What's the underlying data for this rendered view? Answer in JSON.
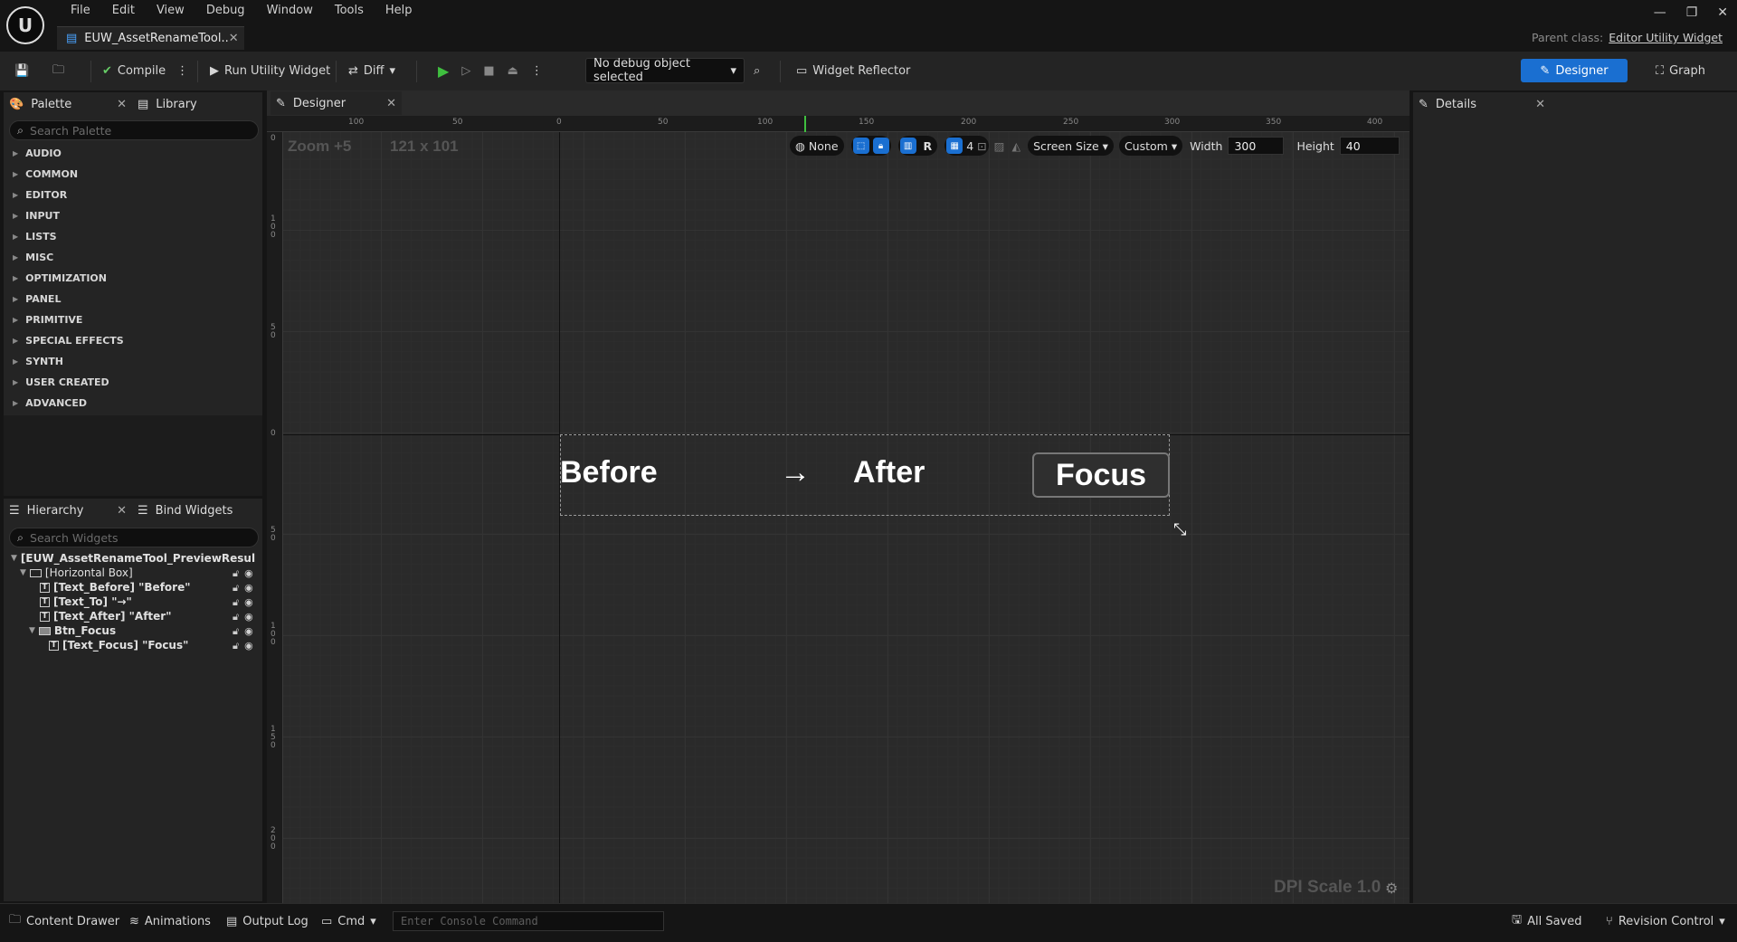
{
  "menu": [
    "File",
    "Edit",
    "View",
    "Debug",
    "Window",
    "Tools",
    "Help"
  ],
  "doc_tab": "EUW_AssetRenameTool..",
  "parent_class": {
    "label": "Parent class:",
    "value": "Editor Utility Widget"
  },
  "toolbar": {
    "compile": "Compile",
    "run": "Run Utility Widget",
    "diff": "Diff",
    "debug": "No debug object selected",
    "reflector": "Widget Reflector",
    "designer": "Designer",
    "graph": "Graph"
  },
  "palette": {
    "tab": "Palette",
    "library": "Library",
    "search_placeholder": "Search Palette",
    "categories": [
      "AUDIO",
      "COMMON",
      "EDITOR",
      "INPUT",
      "LISTS",
      "MISC",
      "OPTIMIZATION",
      "PANEL",
      "PRIMITIVE",
      "SPECIAL EFFECTS",
      "SYNTH",
      "USER CREATED",
      "ADVANCED"
    ]
  },
  "hierarchy": {
    "tab": "Hierarchy",
    "bind": "Bind Widgets",
    "search_placeholder": "Search Widgets",
    "items": [
      "[EUW_AssetRenameTool_PreviewResul",
      "[Horizontal Box]",
      "[Text_Before] \"Before\"",
      "[Text_To] \"→\"",
      "[Text_After] \"After\"",
      "Btn_Focus",
      "[Text_Focus] \"Focus\""
    ]
  },
  "designer": {
    "tab": "Designer",
    "zoom": "Zoom +5",
    "size": "121 x 101",
    "ruler_h": [
      "100",
      "50",
      "0",
      "50",
      "100",
      "150",
      "200",
      "250",
      "300",
      "350",
      "400"
    ],
    "ruler_v": [
      "0",
      "1 0 0",
      "5 0",
      "0",
      "5 0",
      "1 0 0",
      "1 5 0",
      "2 0 0"
    ],
    "none": "None",
    "r": "R",
    "grid_num": "4",
    "screen_size": "Screen Size",
    "custom": "Custom",
    "width_label": "Width",
    "width": "300",
    "height_label": "Height",
    "height": "40",
    "dpi": "DPI Scale 1.0"
  },
  "preview": {
    "before": "Before",
    "arrow": "→",
    "after": "After",
    "focus": "Focus"
  },
  "details": {
    "tab": "Details"
  },
  "status": {
    "content": "Content Drawer",
    "anim": "Animations",
    "output": "Output Log",
    "cmd": "Cmd",
    "console_placeholder": "Enter Console Command",
    "saved": "All Saved",
    "revision": "Revision Control"
  }
}
